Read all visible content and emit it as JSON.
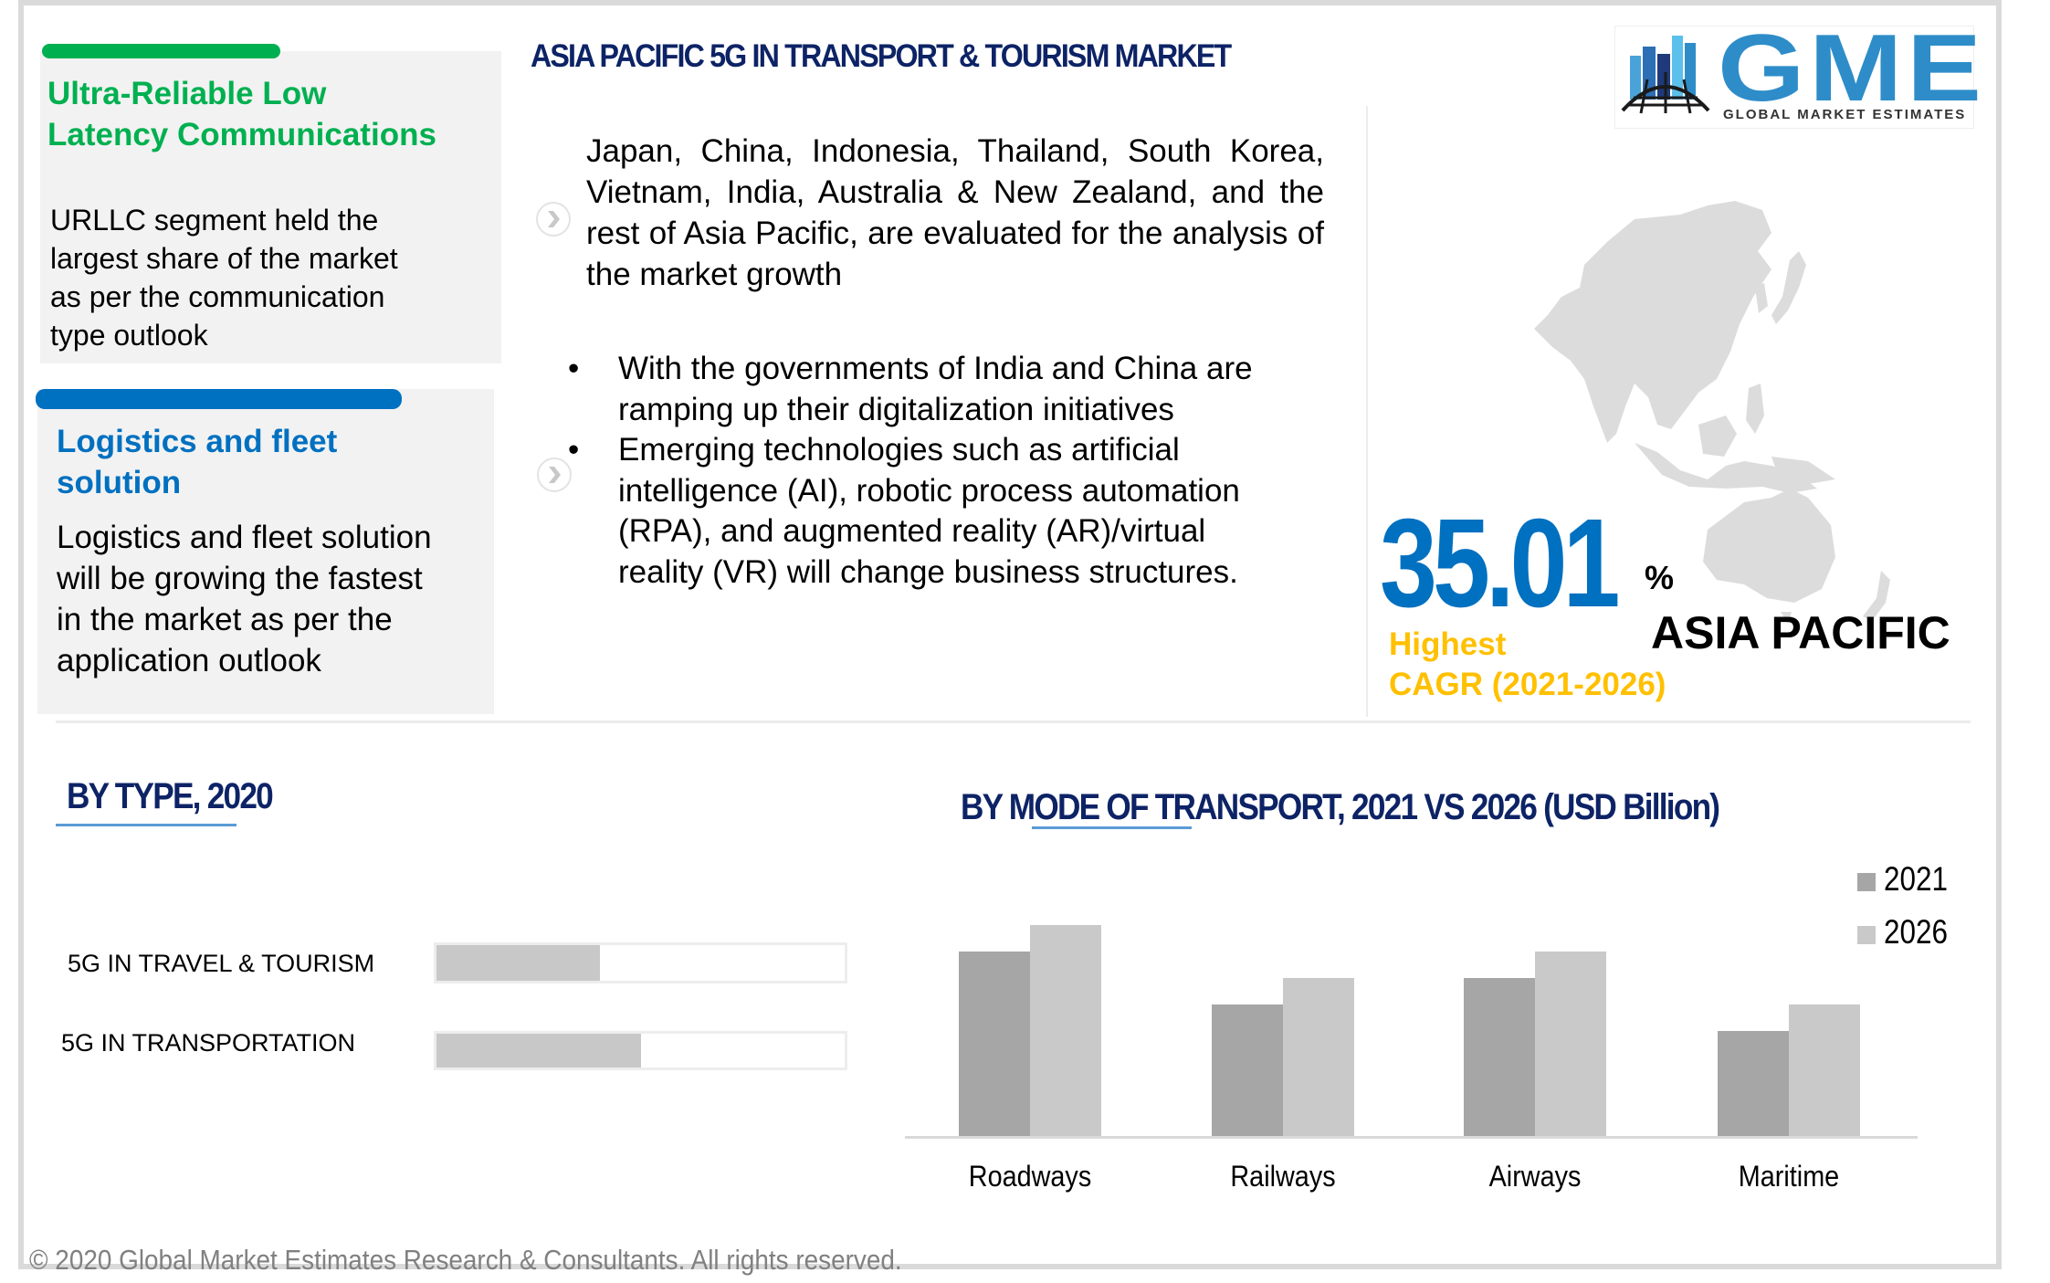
{
  "header": {
    "title": "ASIA PACIFIC 5G IN TRANSPORT & TOURISM MARKET"
  },
  "logo": {
    "wordmark": "GME",
    "tagline": "GLOBAL MARKET ESTIMATES",
    "colors": {
      "primary": "#2e8dc9",
      "dark": "#1e3a7a",
      "globe": "#1a1a1a"
    }
  },
  "highlights": [
    {
      "accent": "#00b050",
      "title": "Ultra-Reliable Low Latency Communications",
      "title_lines": [
        "Ultra-Reliable Low",
        "Latency Communications"
      ],
      "body_lines": [
        "URLLC segment held the",
        "largest share of the market",
        "as per the communication",
        "type outlook"
      ]
    },
    {
      "accent": "#0070c0",
      "title": "Logistics and fleet solution",
      "title_lines": [
        "Logistics and fleet",
        "solution"
      ],
      "body_lines": [
        "Logistics and fleet solution",
        "will be growing the fastest",
        "in the market as per the",
        "application outlook"
      ]
    }
  ],
  "overview": {
    "paragraph": "Japan, China, Indonesia, Thailand, South Korea, Vietnam, India, Australia & New Zealand, and the rest of Asia Pacific, are evaluated for the analysis of the market growth",
    "bullets": [
      "With the governments of India and China are ramping up their digitalization initiatives",
      "Emerging technologies such as artificial intelligence (AI), robotic process automation (RPA), and augmented reality (AR)/virtual reality (VR) will change business structures."
    ],
    "bullet_glyph": "•",
    "arrow_icon": "chevron-right-circle-icon"
  },
  "cagr": {
    "value": "35.01",
    "unit": "%",
    "label_lines": [
      "Highest",
      "CAGR (2021-2026)"
    ],
    "region": "ASIA PACIFIC",
    "colors": {
      "value": "#0070c0",
      "label": "#ffc000"
    }
  },
  "by_type": {
    "title": "BY TYPE, 2020",
    "items": [
      {
        "label": "5G IN TRAVEL & TOURISM",
        "share": 0.4
      },
      {
        "label": "5G IN TRANSPORTATION",
        "share": 0.5
      }
    ]
  },
  "chart_data": {
    "type": "bar",
    "title": "BY MODE OF TRANSPORT, 2021 VS 2026 (USD Billion)",
    "xlabel": "",
    "ylabel": "",
    "categories": [
      "Roadways",
      "Railways",
      "Airways",
      "Maritime"
    ],
    "series": [
      {
        "name": "2021",
        "color": "#a6a6a6",
        "values": [
          7,
          5,
          6,
          4
        ]
      },
      {
        "name": "2026",
        "color": "#c9c9c9",
        "values": [
          8,
          6,
          7,
          5
        ]
      }
    ],
    "ylim": [
      0,
      8.5
    ],
    "value_note": "relative values (no y-axis shown)",
    "grid": false,
    "legend": "top-right"
  },
  "footer": {
    "text": "© 2020 Global Market Estimates Research & Consultants. All rights reserved."
  }
}
